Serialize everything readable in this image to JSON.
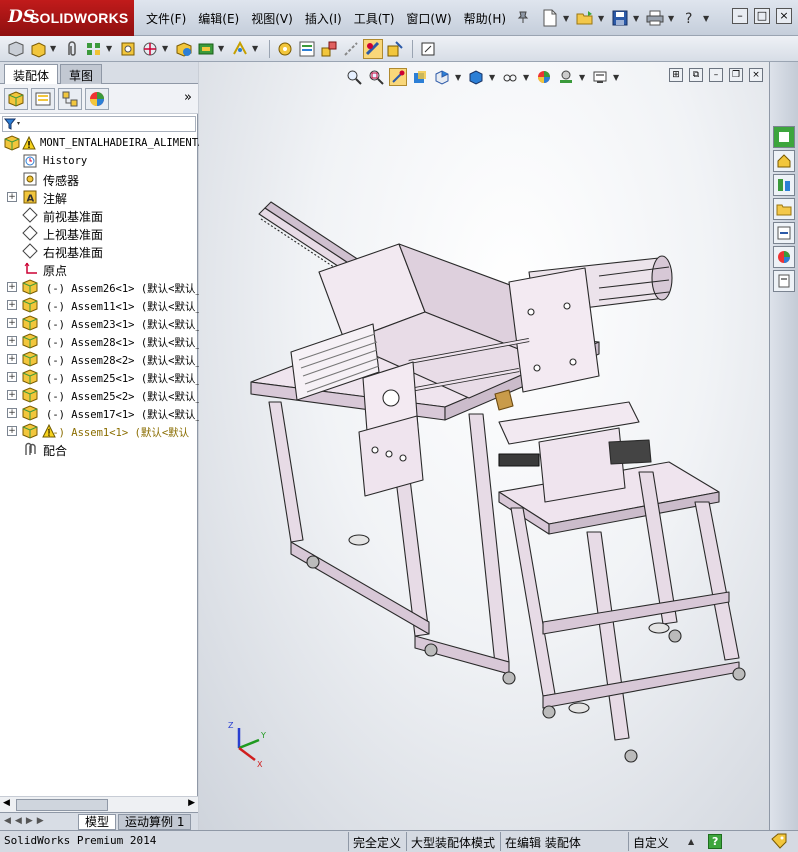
{
  "app": {
    "brand_ds": "DS",
    "brand_name": "SOLIDWORKS",
    "menus": [
      "文件(F)",
      "编辑(E)",
      "视图(V)",
      "插入(I)",
      "工具(T)",
      "窗口(W)",
      "帮助(H)"
    ]
  },
  "panel": {
    "tabs": [
      "装配体",
      "草图"
    ],
    "more": "»",
    "tree": {
      "root": "MONT_ENTALHADEIRA_ALIMENTA",
      "items": [
        {
          "label": "History",
          "expand": false,
          "mono": true
        },
        {
          "label": "传感器",
          "expand": false
        },
        {
          "label": "注解",
          "expand": true
        },
        {
          "label": "前视基准面",
          "expand": false
        },
        {
          "label": "上视基准面",
          "expand": false
        },
        {
          "label": "右视基准面",
          "expand": false
        },
        {
          "label": "原点",
          "expand": false
        }
      ],
      "components": [
        {
          "label": "(-) Assem26<1> (默认<默认_",
          "warn": false
        },
        {
          "label": "(-) Assem11<1> (默认<默认_",
          "warn": false
        },
        {
          "label": "(-) Assem23<1> (默认<默认_",
          "warn": false
        },
        {
          "label": "(-) Assem28<1> (默认<默认_",
          "warn": false
        },
        {
          "label": "(-) Assem28<2> (默认<默认_",
          "warn": false
        },
        {
          "label": "(-) Assem25<1> (默认<默认_",
          "warn": false
        },
        {
          "label": "(-) Assem25<2> (默认<默认_",
          "warn": false
        },
        {
          "label": "(-) Assem17<1> (默认<默认_",
          "warn": false
        },
        {
          "label": "(-) Assem1<1> (默认<默认",
          "warn": true
        }
      ],
      "mates": "配合"
    },
    "bottom_tabs": [
      "模型",
      "运动算例 1"
    ]
  },
  "triad": {
    "z": "Z",
    "y": "Y",
    "x": "X"
  },
  "status": {
    "app_name": "SolidWorks Premium 2014",
    "cells": [
      "完全定义",
      "大型装配体模式",
      "在编辑 装配体",
      "自定义",
      "?"
    ]
  },
  "colors": {
    "accent_red": "#b3141a",
    "part_body": "#e7dbe6",
    "part_edge": "#2a2a2a"
  }
}
